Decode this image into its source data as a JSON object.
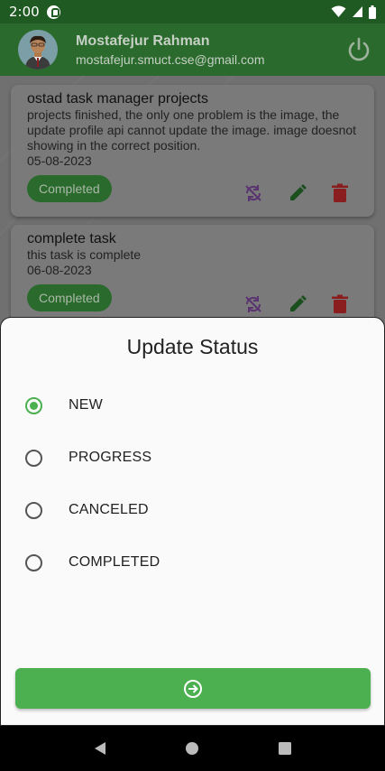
{
  "status_bar": {
    "time": "2:00",
    "icons": [
      "p-app-icon",
      "wifi-icon",
      "signal-icon",
      "battery-icon"
    ]
  },
  "header": {
    "user_name": "Mostafejur Rahman",
    "user_email": "mostafejur.smuct.cse@gmail.com",
    "icons": [
      "avatar",
      "power-icon"
    ]
  },
  "tasks": [
    {
      "title": "ostad task manager projects",
      "description": "projects finished, the only one problem is the image, the update profile api cannot update the image. image doesnot showing in the correct position.",
      "date": "05-08-2023",
      "status": "Completed"
    },
    {
      "title": "complete task",
      "description": "this task is complete",
      "date": "06-08-2023",
      "status": "Completed"
    }
  ],
  "sheet": {
    "title": "Update Status",
    "options": [
      {
        "label": "NEW",
        "selected": true
      },
      {
        "label": "PROGRESS",
        "selected": false
      },
      {
        "label": "CANCELED",
        "selected": false
      },
      {
        "label": "COMPLETED",
        "selected": false
      }
    ],
    "submit_icon": "arrow-circle-right-icon"
  },
  "colors": {
    "accent": "#4caf50",
    "appbar": "#2a6b2d",
    "edit": "#1f6b22",
    "delete": "#c62828",
    "sync": "#6a3a8a"
  },
  "nav_bar": {
    "icons": [
      "back-icon",
      "home-icon",
      "recents-icon"
    ]
  }
}
